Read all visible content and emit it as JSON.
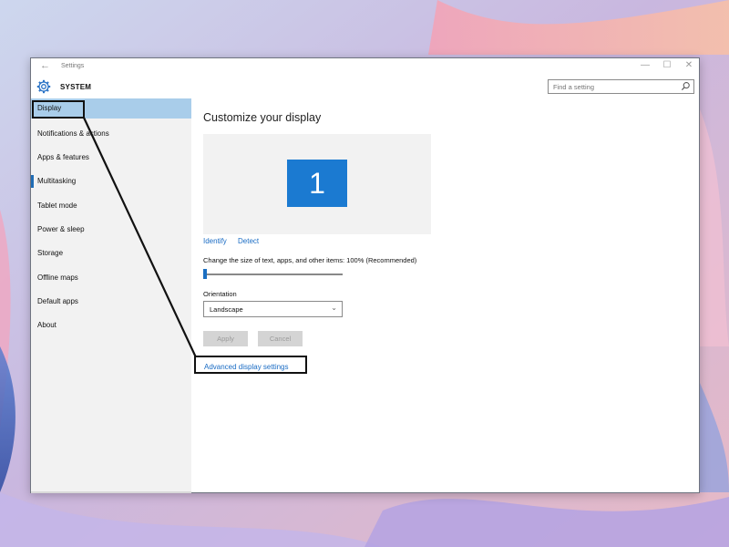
{
  "window": {
    "title": "Settings",
    "back_glyph": "←",
    "controls": {
      "minimize": "—",
      "maximize": "☐",
      "close": "✕"
    }
  },
  "header": {
    "section": "SYSTEM",
    "icon": "gear-icon",
    "search": {
      "placeholder": "Find a setting",
      "value": "",
      "icon": "search-icon"
    }
  },
  "sidebar": {
    "items": [
      {
        "label": "Display",
        "selected": true
      },
      {
        "label": "Notifications & actions"
      },
      {
        "label": "Apps & features"
      },
      {
        "label": "Multitasking"
      },
      {
        "label": "Tablet mode"
      },
      {
        "label": "Power & sleep"
      },
      {
        "label": "Storage"
      },
      {
        "label": "Offline maps"
      },
      {
        "label": "Default apps"
      },
      {
        "label": "About"
      }
    ]
  },
  "main": {
    "title": "Customize your display",
    "monitor_label": "1",
    "links": {
      "identify": "Identify",
      "detect": "Detect"
    },
    "scale": {
      "label": "Change the size of text, apps, and other items: 100% (Recommended)",
      "value": 0
    },
    "orientation": {
      "label": "Orientation",
      "value": "Landscape"
    },
    "buttons": {
      "apply": "Apply",
      "cancel": "Cancel"
    },
    "advanced_link": "Advanced display settings"
  },
  "colors": {
    "accent": "#1b7ad1",
    "selection": "#a9cdea",
    "sidebar_bg": "#f2f2f2",
    "link": "#1a6cc4",
    "annotation": "#111111"
  }
}
